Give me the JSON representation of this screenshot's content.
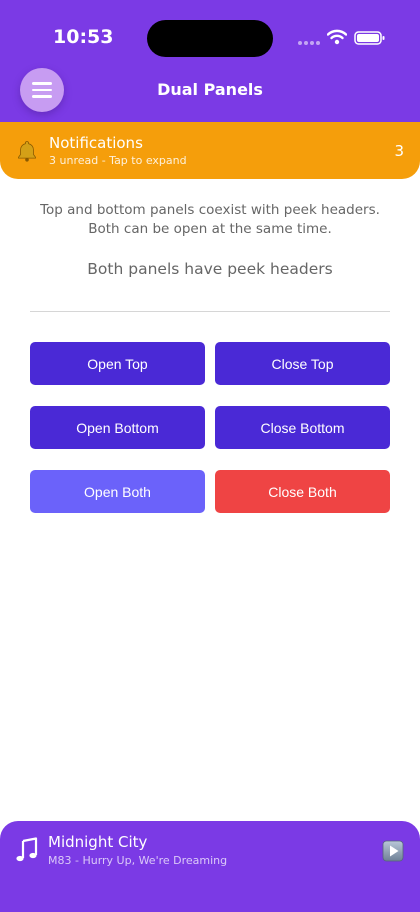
{
  "status_bar": {
    "time": "10:53"
  },
  "nav": {
    "title": "Dual Panels"
  },
  "notifications": {
    "title": "Notifications",
    "subtitle": "3 unread - Tap to expand",
    "count": "3"
  },
  "main": {
    "description_line1": "Top and bottom panels coexist with peek headers.",
    "description_line2": "Both can be open at the same time.",
    "state_text": "Both panels have peek headers"
  },
  "buttons": {
    "open_top": "Open Top",
    "close_top": "Close Top",
    "open_bottom": "Open Bottom",
    "close_bottom": "Close Bottom",
    "open_both": "Open Both",
    "close_both": "Close Both"
  },
  "player": {
    "title": "Midnight City",
    "subtitle": "M83 - Hurry Up, We're Dreaming"
  },
  "colors": {
    "header_purple": "#7b3ae5",
    "notification_amber": "#f59e0b",
    "button_indigo": "#4a29d6",
    "button_periwinkle": "#6b62fa",
    "button_red": "#ef4444"
  },
  "icons": [
    "hamburger-menu-icon",
    "wifi-icon",
    "battery-icon",
    "bell-icon",
    "music-note-icon",
    "play-icon"
  ]
}
